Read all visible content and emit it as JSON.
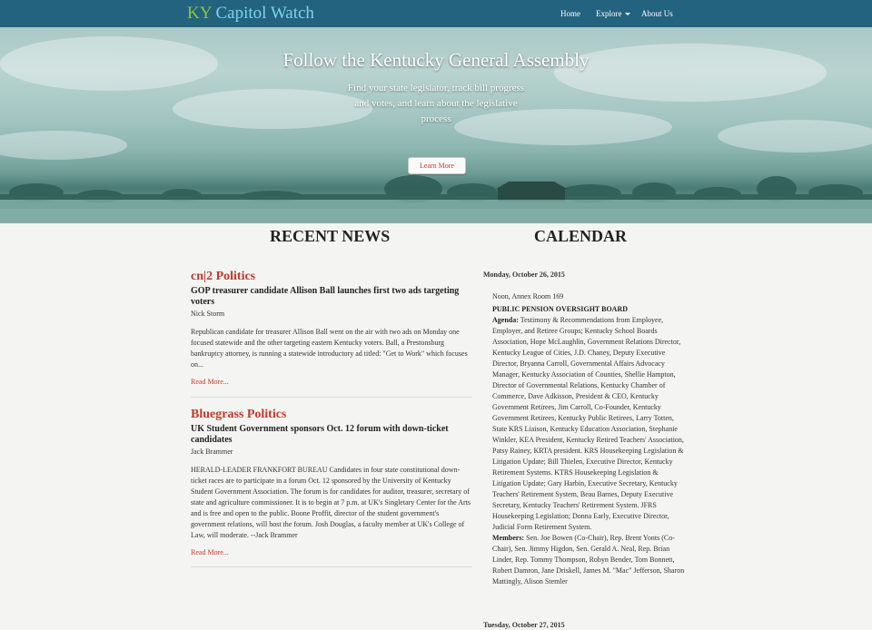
{
  "brand": {
    "ky": "KY",
    "name": "Capitol Watch"
  },
  "nav": {
    "home": "Home",
    "explore": "Explore",
    "about": "About Us"
  },
  "hero": {
    "title": "Follow the Kentucky General Assembly",
    "subtitle": "Find your state legislator, track bill progress and votes, and learn about the legislative process",
    "button": "Learn More"
  },
  "sections": {
    "news": "RECENT NEWS",
    "calendar": "CALENDAR"
  },
  "news": [
    {
      "source": "cn|2 Politics",
      "headline": "GOP treasurer candidate Allison Ball launches first two ads targeting voters",
      "author": "Nick Storm",
      "excerpt": "Republican candidate for treasurer Allison Ball went on the air with two ads on Monday one focused statewide and the other targeting eastern Kentucky voters. Ball, a Prestonsburg bankruptcy attorney, is running a statewide introductory ad titled: \"Get to Work\" which focuses on...",
      "read_more": "Read More..."
    },
    {
      "source": "Bluegrass Politics",
      "headline": "UK Student Government sponsors Oct. 12 forum with down-ticket candidates",
      "author": "Jack Brammer",
      "excerpt": "HERALD-LEADER FRANKFORT BUREAU Candidates in four state constitutional down-ticket races are to participate in a forum Oct. 12 sponsored by the University of Kentucky Student Government Association. The forum is for candidates for auditor, treasurer, secretary of state and agriculture commissioner. It is to begin at 7 p.m. at UK's Singletary Center for the Arts and is free and open to the public. Boone Proffit, director of the student government's government relations, will host the forum. Josh Douglas, a faculty member at UK's College of Law, will moderate. --Jack Brammer",
      "read_more": "Read More..."
    }
  ],
  "calendar": {
    "date": "Monday, October 26, 2015",
    "event": {
      "time_location": "Noon, Annex Room 169",
      "title": "PUBLIC PENSION OVERSIGHT BOARD",
      "agenda_label": "Agenda:",
      "agenda": "Testimony & Recommendations from Employee, Employer, and Retiree Groups; Kentucky School Boards Association, Hope McLaughlin, Government Relations Director, Kentucky League of Cities, J.D. Chaney, Deputy Executive Director, Bryanna Carroll, Governmental Affairs Advocacy Manager, Kentucky Association of Counties, Shellie Hampton, Director of Governmental Relations, Kentucky Chamber of Commerce, Dave Adkisson, President & CEO, Kentucky Government Retirees, Jim Carroll, Co-Founder, Kentucky Government Retirees, Kentucky Public Retirees, Larry Totten, State KRS Liaison, Kentucky Education Association, Stephanie Winkler, KEA President, Kentucky Retired Teachers' Association, Patsy Rainey, KRTA president. KRS Housekeeping Legislation & Litigation Update; Bill Thielen, Executive Director, Kentucky Retirement Systems. KTRS Housekeeping Legislation & Litigation Update; Gary Harbin, Executive Secretary, Kentucky Teachers' Retirement System, Beau Barnes, Deputy Executive Secretary, Kentucky Teachers' Retirement System. JFRS Housekeeping Legislation; Donna Early, Executive Director, Judicial Form Retirement System.",
      "members_label": "Members:",
      "members": "Sen. Joe Bowen (Co-Chair), Rep. Brent Yonts (Co-Chair), Sen. Jimmy Higdon, Sen. Gerald A. Neal, Rep. Brian Linder, Rep. Tommy Thompson, Robyn Bender, Tom Bonnett, Robert Damron, Jane Driskell, James M. \"Mac\" Jefferson, Sharon Mattingly, Alison Stemler"
    },
    "next_date": "Tuesday, October 27, 2015"
  }
}
